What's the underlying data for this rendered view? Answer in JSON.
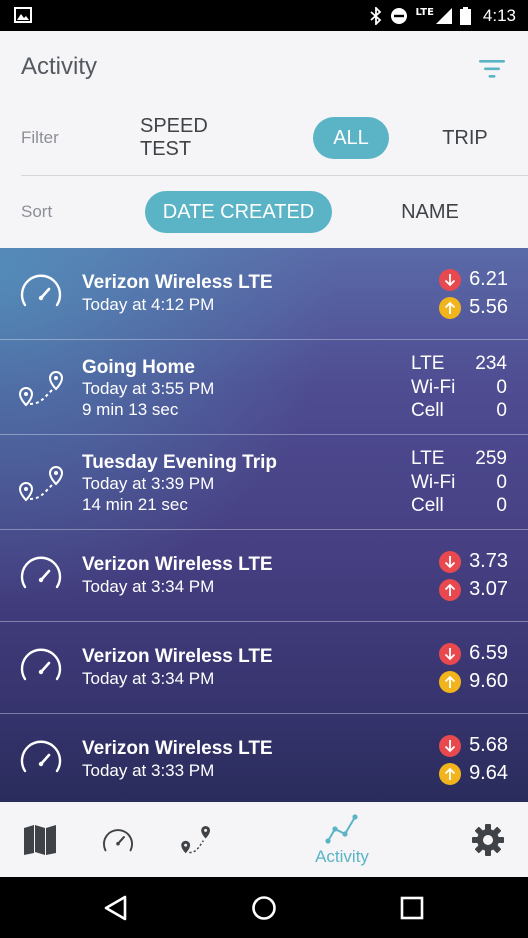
{
  "status_bar": {
    "time": "4:13",
    "network": "LTE"
  },
  "header": {
    "title": "Activity"
  },
  "filter": {
    "label": "Filter",
    "options": [
      "SPEED TEST",
      "ALL",
      "TRIP"
    ],
    "selected": "ALL"
  },
  "sort": {
    "label": "Sort",
    "options": [
      "DATE CREATED",
      "NAME"
    ],
    "selected": "DATE CREATED"
  },
  "colors": {
    "accent": "#5bb4c6",
    "download_arrow": "#e8494f",
    "upload_arrow_yellow": "#f2b41c",
    "upload_arrow_red": "#e8494f"
  },
  "items": [
    {
      "type": "speed",
      "name": "Verizon Wireless LTE",
      "time": "Today at 4:12 PM",
      "download": "6.21",
      "upload": "5.56",
      "upload_color": "yellow"
    },
    {
      "type": "trip",
      "name": "Going Home",
      "time": "Today at 3:55 PM",
      "duration": "9 min 13 sec",
      "rows": [
        {
          "label": "LTE",
          "value": "234"
        },
        {
          "label": "Wi-Fi",
          "value": "0"
        },
        {
          "label": "Cell",
          "value": "0"
        }
      ]
    },
    {
      "type": "trip",
      "name": "Tuesday Evening Trip",
      "time": "Today at 3:39 PM",
      "duration": "14 min 21 sec",
      "rows": [
        {
          "label": "LTE",
          "value": "259"
        },
        {
          "label": "Wi-Fi",
          "value": "0"
        },
        {
          "label": "Cell",
          "value": "0"
        }
      ]
    },
    {
      "type": "speed",
      "name": "Verizon Wireless LTE",
      "time": "Today at 3:34 PM",
      "download": "3.73",
      "upload": "3.07",
      "upload_color": "red"
    },
    {
      "type": "speed",
      "name": "Verizon Wireless LTE",
      "time": "Today at 3:34 PM",
      "download": "6.59",
      "upload": "9.60",
      "upload_color": "yellow"
    },
    {
      "type": "speed",
      "name": "Verizon Wireless LTE",
      "time": "Today at 3:33 PM",
      "download": "5.68",
      "upload": "9.64",
      "upload_color": "yellow"
    }
  ],
  "bottom_nav": {
    "tabs": [
      {
        "icon": "map-icon",
        "label": ""
      },
      {
        "icon": "speedometer-icon",
        "label": ""
      },
      {
        "icon": "trip-icon",
        "label": ""
      },
      {
        "icon": "activity-icon",
        "label": "Activity"
      },
      {
        "icon": "gear-icon",
        "label": ""
      }
    ],
    "active": "Activity"
  }
}
